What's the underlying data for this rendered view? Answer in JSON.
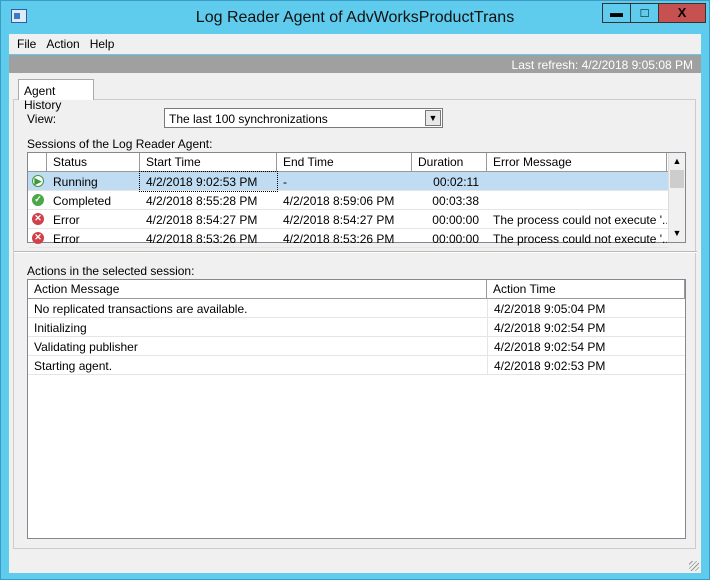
{
  "window": {
    "title": "Log Reader Agent of AdvWorksProductTrans",
    "minimize": "▬",
    "maximize": "□",
    "close": "X"
  },
  "menu": [
    "File",
    "Action",
    "Help"
  ],
  "last_refresh": "Last refresh: 4/2/2018 9:05:08 PM",
  "tab": "Agent History",
  "view": {
    "label": "View:",
    "selected": "The last 100 synchronizations"
  },
  "sessions": {
    "label": "Sessions of the Log Reader Agent:",
    "columns": [
      "Status",
      "Start Time",
      "End Time",
      "Duration",
      "Error Message"
    ],
    "rows": [
      {
        "icon": "running-icon",
        "status": "Running",
        "start": "4/2/2018 9:02:53 PM",
        "end": "-",
        "duration": "00:02:11",
        "error": ""
      },
      {
        "icon": "completed-icon",
        "status": "Completed",
        "start": "4/2/2018 8:55:28 PM",
        "end": "4/2/2018 8:59:06 PM",
        "duration": "00:03:38",
        "error": ""
      },
      {
        "icon": "error-icon",
        "status": "Error",
        "start": "4/2/2018 8:54:27 PM",
        "end": "4/2/2018 8:54:27 PM",
        "duration": "00:00:00",
        "error": "The process could not execute '..."
      },
      {
        "icon": "error-icon",
        "status": "Error",
        "start": "4/2/2018 8:53:26 PM",
        "end": "4/2/2018 8:53:26 PM",
        "duration": "00:00:00",
        "error": "The process could not execute '..."
      }
    ]
  },
  "actions": {
    "label": "Actions in the selected session:",
    "columns": [
      "Action Message",
      "Action Time"
    ],
    "rows": [
      {
        "message": "No replicated transactions are available.",
        "time": "4/2/2018 9:05:04 PM"
      },
      {
        "message": "Initializing",
        "time": "4/2/2018 9:02:54 PM"
      },
      {
        "message": "Validating publisher",
        "time": "4/2/2018 9:02:54 PM"
      },
      {
        "message": "Starting agent.",
        "time": "4/2/2018 9:02:53 PM"
      }
    ]
  },
  "colors": {
    "titlebar": "#5fcbed",
    "close": "#c75050",
    "selection": "#c0dcf3",
    "refresh_bar": "#a0a0a0"
  }
}
